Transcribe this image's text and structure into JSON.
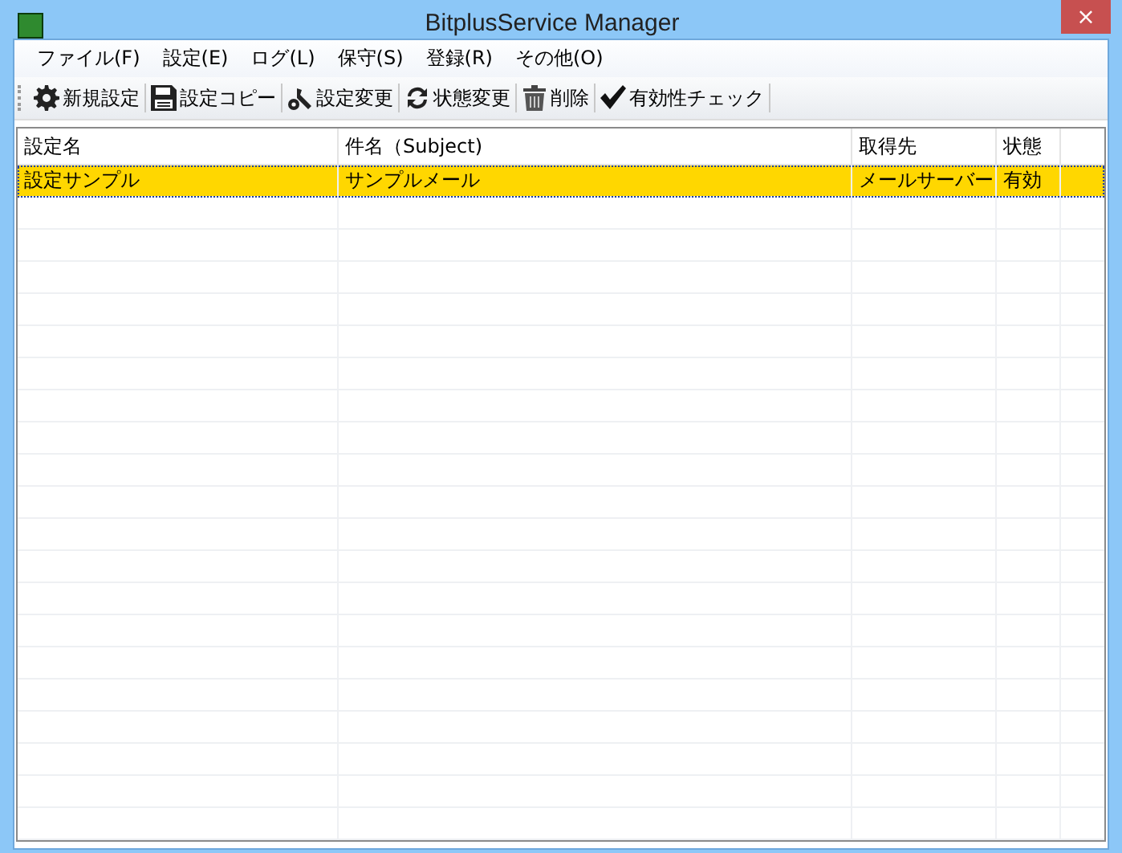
{
  "window": {
    "title": "BitplusService Manager",
    "close": "×"
  },
  "menu": [
    "ファイル(F)",
    "設定(E)",
    "ログ(L)",
    "保守(S)",
    "登録(R)",
    "その他(O)"
  ],
  "toolbar": [
    {
      "kind": "gear",
      "label": "新規設定"
    },
    {
      "kind": "save",
      "label": "設定コピー"
    },
    {
      "kind": "tools",
      "label": "設定変更"
    },
    {
      "kind": "refresh",
      "label": "状態変更"
    },
    {
      "kind": "trash",
      "label": "削除"
    },
    {
      "kind": "check",
      "label": "有効性チェック"
    }
  ],
  "table": {
    "columns": [
      "設定名",
      "件名（Subject)",
      "取得先",
      "状態"
    ],
    "rows": [
      {
        "cells": [
          "設定サンプル",
          "サンプルメール",
          "メールサーバー",
          "有効"
        ],
        "selected": true
      }
    ]
  }
}
